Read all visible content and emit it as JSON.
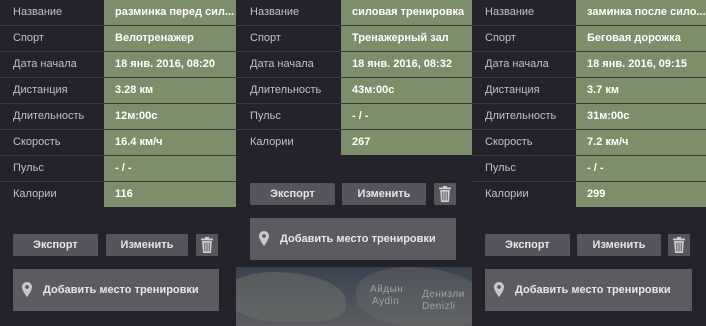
{
  "labels": {
    "name": "Название",
    "sport": "Спорт",
    "start": "Дата начала",
    "distance": "Дистанция",
    "duration": "Длительность",
    "speed": "Скорость",
    "pulse": "Пульс",
    "calories": "Калории"
  },
  "buttons": {
    "export": "Экспорт",
    "edit": "Изменить",
    "add_place": "Добавить место тренировки"
  },
  "workouts": [
    {
      "name": "разминка перед сил...",
      "sport": "Велотренажер",
      "start": "18 янв. 2016, 08:20",
      "distance": "3.28 км",
      "duration": "12м:00с",
      "speed": "16.4 км/ч",
      "pulse": "- / -",
      "calories": "116"
    },
    {
      "name": "силовая тренировка",
      "sport": "Тренажерный зал",
      "start": "18 янв. 2016, 08:32",
      "duration": "43м:00с",
      "pulse": "- / -",
      "calories": "267"
    },
    {
      "name": "заминка после сило...",
      "sport": "Беговая дорожка",
      "start": "18 янв. 2016, 09:15",
      "distance": "3.7 км",
      "duration": "31м:00с",
      "speed": "7.2 км/ч",
      "pulse": "- / -",
      "calories": "299"
    }
  ],
  "map": {
    "labels": [
      "Айдын",
      "Aydin",
      "Денизли",
      "Denizli"
    ]
  }
}
